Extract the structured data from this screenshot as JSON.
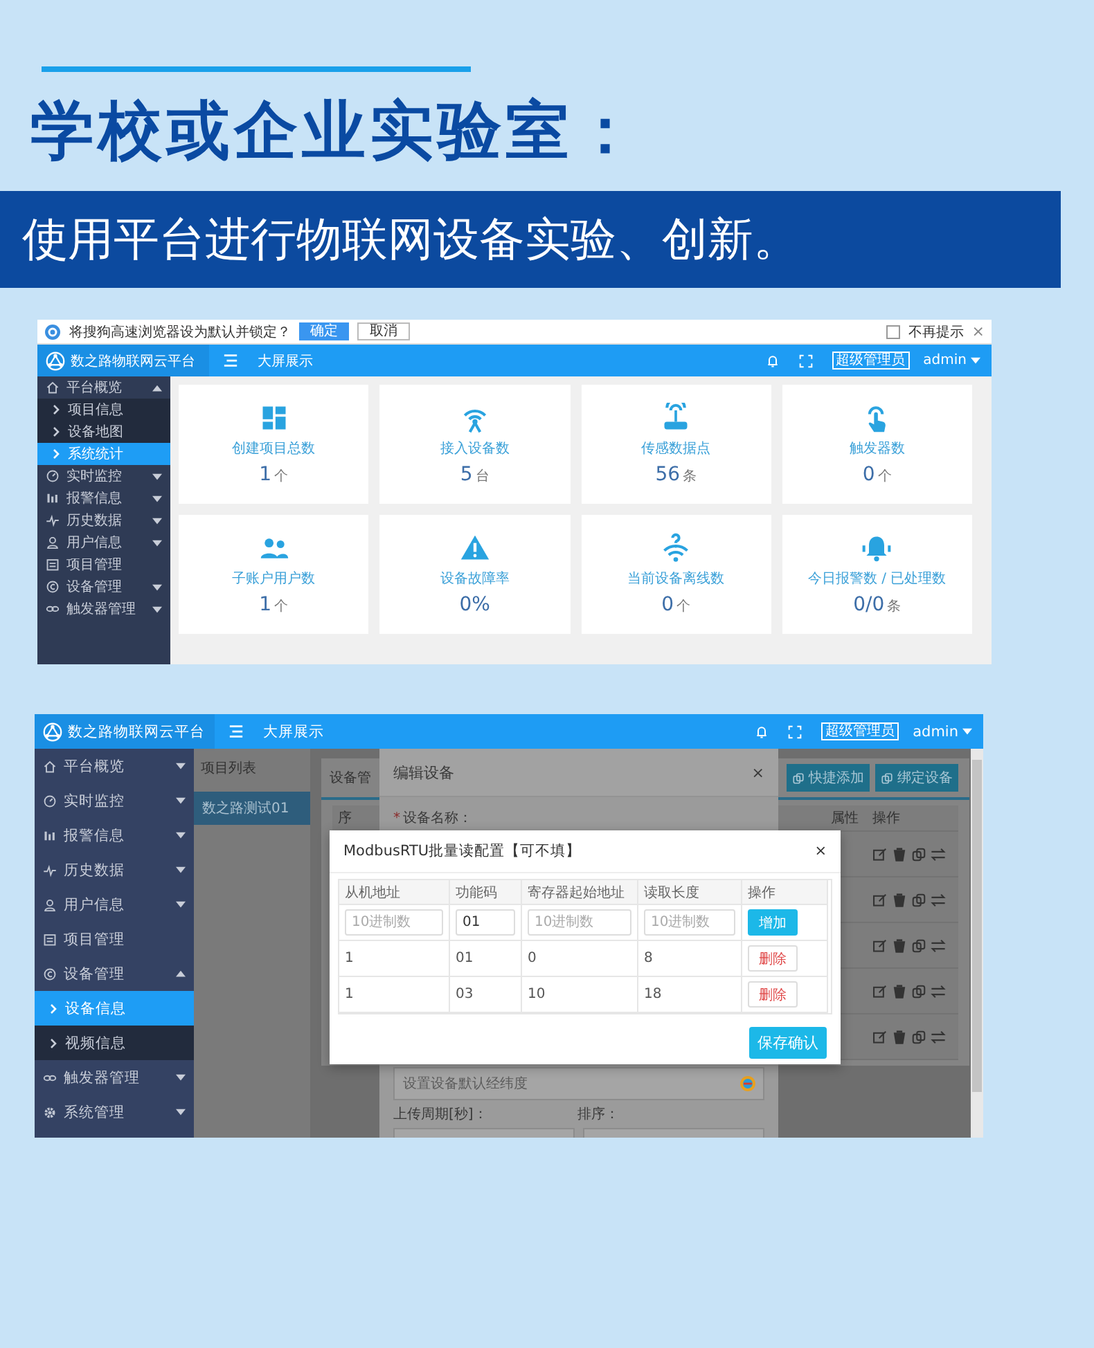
{
  "headline": "学校或企业实验室：",
  "subtitle": "使用平台进行物联网设备实验、创新。",
  "dashboard": {
    "prompt_bar": {
      "message": "将搜狗高速浏览器设为默认并锁定？",
      "confirm": "确定",
      "cancel": "取消",
      "dont_remind": {
        "label": "不再提示",
        "checked": false
      },
      "close": "×"
    },
    "header": {
      "brand": "数之路物联网云平台",
      "nav_link": "大屏展示",
      "role": "超级管理员",
      "user": "admin"
    },
    "sidebar": [
      {
        "kind": "group",
        "label": "平台概览",
        "expanded": true,
        "selected": false,
        "children": [
          {
            "label": "项目信息",
            "selected": false
          },
          {
            "label": "设备地图",
            "selected": false
          },
          {
            "label": "系统统计",
            "selected": true
          }
        ]
      },
      {
        "kind": "group",
        "label": "实时监控",
        "expanded": false,
        "selected": false
      },
      {
        "kind": "group",
        "label": "报警信息",
        "expanded": false,
        "selected": false
      },
      {
        "kind": "group",
        "label": "历史数据",
        "expanded": false,
        "selected": false
      },
      {
        "kind": "group",
        "label": "用户信息",
        "expanded": false,
        "selected": false
      },
      {
        "kind": "link",
        "label": "项目管理",
        "selected": false
      },
      {
        "kind": "group",
        "label": "设备管理",
        "expanded": false,
        "selected": false
      },
      {
        "kind": "group",
        "label": "触发器管理",
        "expanded": false,
        "selected": false
      }
    ],
    "stat_cards": [
      {
        "label": "创建项目总数",
        "value": "1",
        "unit": "个"
      },
      {
        "label": "接入设备数",
        "value": "5",
        "unit": "台"
      },
      {
        "label": "传感数据点",
        "value": "56",
        "unit": "条"
      },
      {
        "label": "触发器数",
        "value": "0",
        "unit": "个"
      },
      {
        "label": "子账户用户数",
        "value": "1",
        "unit": "个"
      },
      {
        "label": "设备故障率",
        "value": "0%"
      },
      {
        "label": "当前设备离线数",
        "value": "0",
        "unit": "个"
      },
      {
        "label": "今日报警数 / 已处理数",
        "value": "0/0",
        "unit": "条"
      }
    ]
  },
  "device_screen": {
    "header": {
      "brand": "数之路物联网云平台",
      "nav_link": "大屏展示",
      "role": "超级管理员",
      "user": "admin"
    },
    "sidebar": [
      {
        "kind": "group",
        "label": "平台概览",
        "expanded": false,
        "selected": false
      },
      {
        "kind": "group",
        "label": "实时监控",
        "expanded": false,
        "selected": false
      },
      {
        "kind": "group",
        "label": "报警信息",
        "expanded": false,
        "selected": false
      },
      {
        "kind": "group",
        "label": "历史数据",
        "expanded": false,
        "selected": false
      },
      {
        "kind": "group",
        "label": "用户信息",
        "expanded": false,
        "selected": false
      },
      {
        "kind": "link",
        "label": "项目管理",
        "selected": false
      },
      {
        "kind": "group",
        "label": "设备管理",
        "expanded": true,
        "selected": false,
        "children": [
          {
            "label": "设备信息",
            "selected": true
          },
          {
            "label": "视频信息",
            "selected": false
          }
        ]
      },
      {
        "kind": "group",
        "label": "触发器管理",
        "expanded": false,
        "selected": false
      },
      {
        "kind": "group",
        "label": "系统管理",
        "expanded": false,
        "selected": false
      }
    ],
    "project_list": {
      "title": "项目列表",
      "items": [
        {
          "label": "数之路测试01",
          "selected": true
        }
      ]
    },
    "device_panel": {
      "tab": "设备管",
      "buttons": [
        "快捷添加",
        "绑定设备"
      ],
      "columns": [
        "序",
        "属性",
        "操作"
      ]
    },
    "edit_dialog": {
      "title": "编辑设备",
      "close": "×",
      "required_mark": "*",
      "name_label": "设备名称：",
      "location_placeholder": "设置设备默认经纬度",
      "period_label": "上传周期[秒]：",
      "sort_label": "排序："
    },
    "modbus_dialog": {
      "title": "ModbusRTU批量读配置【可不填】",
      "close": "×",
      "columns": [
        "从机地址",
        "功能码",
        "寄存器起始地址",
        "读取长度",
        "操作"
      ],
      "input_row": [
        {
          "placeholder": "10进制数"
        },
        {
          "value": "01"
        },
        {
          "placeholder": "10进制数"
        },
        {
          "placeholder": "10进制数"
        }
      ],
      "add_button": "增加",
      "rows": [
        {
          "cells": [
            "1",
            "01",
            "0",
            "8"
          ],
          "action": "删除"
        },
        {
          "cells": [
            "1",
            "03",
            "10",
            "18"
          ],
          "action": "删除"
        }
      ],
      "save_button": "保存确认"
    }
  }
}
